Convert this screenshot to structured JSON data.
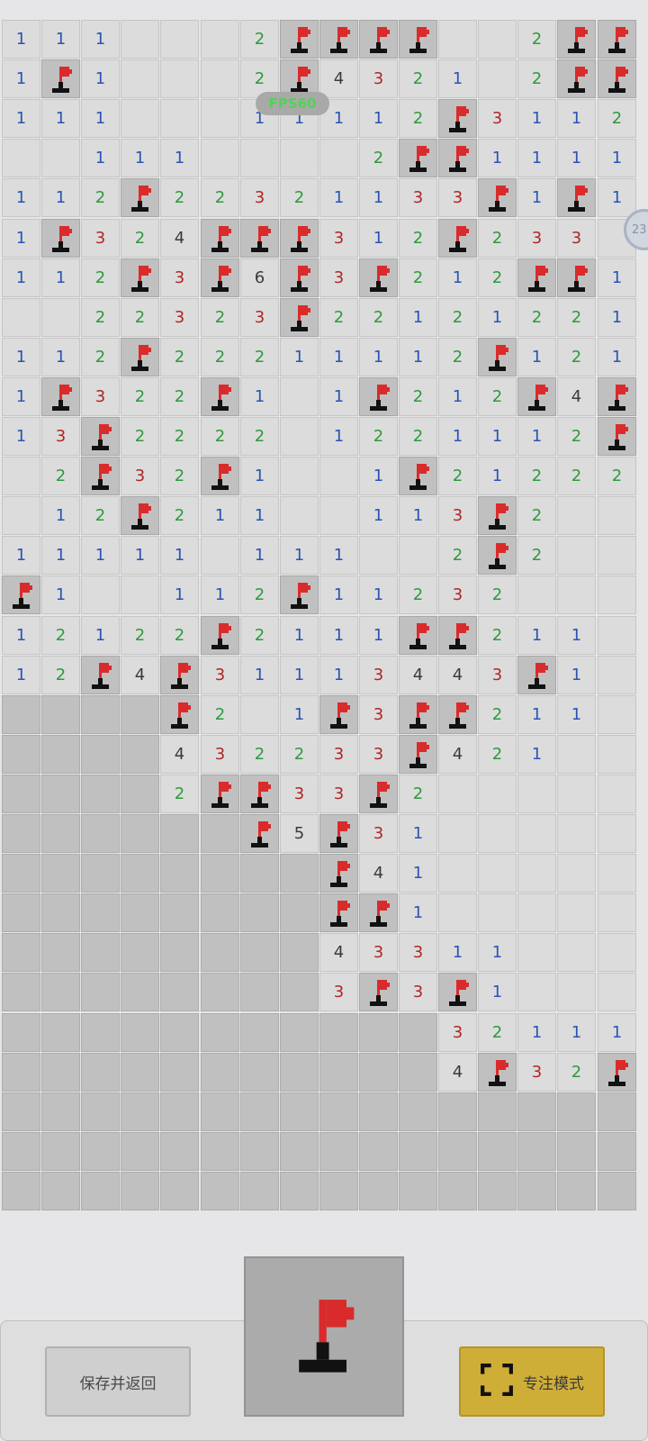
{
  "board": {
    "rows": [
      "111   2FFFF  2FF",
      "1F1   2F4321 2FF",
      "111   11112F3112",
      "  111    2FF1111",
      "112F22321133F1F1",
      "1F324FFF312F233 ",
      "112F3F6F3F212FF1",
      "  22323F22121221",
      "112F22211112F121",
      "1F322F1 1F212F4F",
      "13F2222 1221112FF",
      " 2F32F1  1F21222",
      " 12F211  113F2  ",
      "11111 111  2F2  ",
      "F1  112F11232   ",
      "12122F2111FF211 ",
      "12F4F31113443F1 ",
      "####F2 1F3FF211 ",
      "####432233F421  ",
      "####2FF33F2     ",
      "######F5F31     ",
      "########F41     ",
      "########FF1     ",
      "########43311   ",
      "########3F3F1   ",
      "###########32111",
      "###########4F32F",
      "################",
      "################",
      "################"
    ]
  },
  "fps_label": "FPS60",
  "side_badge": "23",
  "controls": {
    "save_label": "保存并返回",
    "mode_icon": "flag-icon",
    "focus_label": "专注模式",
    "focus_icon": "fullscreen-icon"
  },
  "colors": {
    "n1": "#2a54b4",
    "n2": "#2d9a3b",
    "n3": "#b02626",
    "n4": "#3a3a3a",
    "flag": "#d92b2b",
    "focus_button": "#cfae38"
  }
}
